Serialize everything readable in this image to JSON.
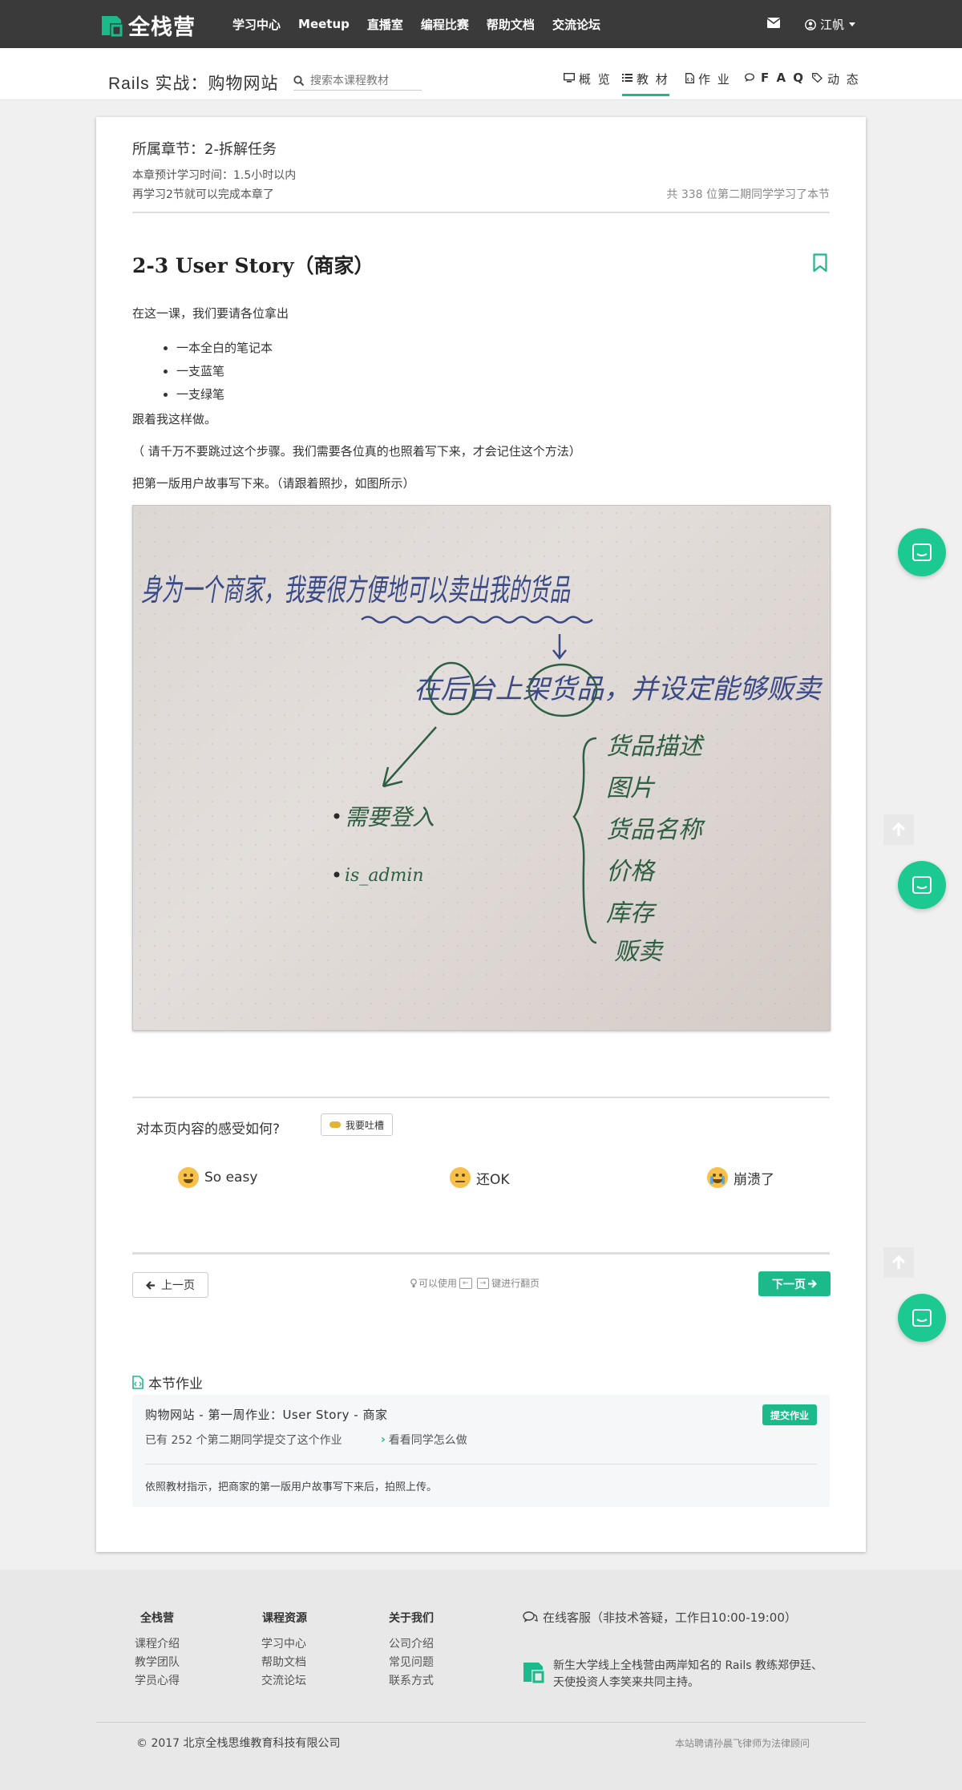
{
  "nav": {
    "brand": "全栈营",
    "links": [
      "学习中心",
      "Meetup",
      "直播室",
      "编程比赛",
      "帮助文档",
      "交流论坛"
    ],
    "user": "江帆"
  },
  "subheader": {
    "course_title": "Rails 实战：购物网站",
    "search_placeholder": "搜索本课程教材",
    "tabs": [
      "概 览",
      "教 材",
      "作 业",
      "F A Q",
      "动 态"
    ],
    "active_tab": "教 材"
  },
  "lesson": {
    "chapter": "所属章节：2-拆解任务",
    "estimate": "本章预计学习时间：1.5小时以内",
    "remaining": "再学习2节就可以完成本章了",
    "learners": "共 338 位第二期同学学习了本节",
    "title": "2-3 User Story（商家）",
    "intro": "在这一课，我们要请各位拿出",
    "items": [
      "一本全白的笔记本",
      "一支蓝笔",
      "一支绿笔"
    ],
    "follow": "跟着我这样做。",
    "note": "（ 请千万不要跳过这个步骤。我们需要各位真的也照着写下来，才会记住这个方法）",
    "instruction": "把第一版用户故事写下来。（请跟着照抄，如图所示）",
    "photo_text": {
      "line1": "身为一个商家，我要很方便地可以卖出我的货品",
      "line2": "在后台上架货品，并设定能够贩卖",
      "left_items": [
        "需要登入",
        "is_admin"
      ],
      "right_items": [
        "货品描述",
        "图片",
        "货品名称",
        "价格",
        "库存",
        "贩卖"
      ]
    }
  },
  "feedback": {
    "question": "对本页内容的感受如何?",
    "complain_label": "我要吐槽",
    "options": [
      "So easy",
      "还OK",
      "崩溃了"
    ]
  },
  "pager": {
    "prev": "上一页",
    "next": "下一页",
    "hint_pre": "可以使用",
    "hint_post": "键进行翻页",
    "key_left": "←",
    "key_right": "→"
  },
  "homework": {
    "section_title": "本节作业",
    "title": "购物网站 - 第一周作业：User Story - 商家",
    "submit": "提交作业",
    "count": "已有 252 个第二期同学提交了这个作业",
    "see_others": "看看同学怎么做",
    "description": "依照教材指示，把商家的第一版用户故事写下来后，拍照上传。"
  },
  "footer": {
    "col1_title": "全栈营",
    "col1": [
      "课程介绍",
      "教学团队",
      "学员心得"
    ],
    "col2_title": "课程资源",
    "col2": [
      "学习中心",
      "帮助文档",
      "交流论坛"
    ],
    "col3_title": "关于我们",
    "col3": [
      "公司介绍",
      "常见问题",
      "联系方式"
    ],
    "service": "在线客服（非技术答疑，工作日10:00-19:00）",
    "about": "新生大学线上全栈营由两岸知名的 Rails 教练郑伊廷、天使投资人李笑来共同主持。",
    "copyright": "© 2017 北京全栈思维教育科技有限公司",
    "legal": "本站聘请孙晨飞律师为法律顾问"
  },
  "colors": {
    "accent": "#1cb98b",
    "topbar": "#3a3a3a",
    "pen_blue": "#3a4a86",
    "pen_green": "#2f5f43"
  }
}
